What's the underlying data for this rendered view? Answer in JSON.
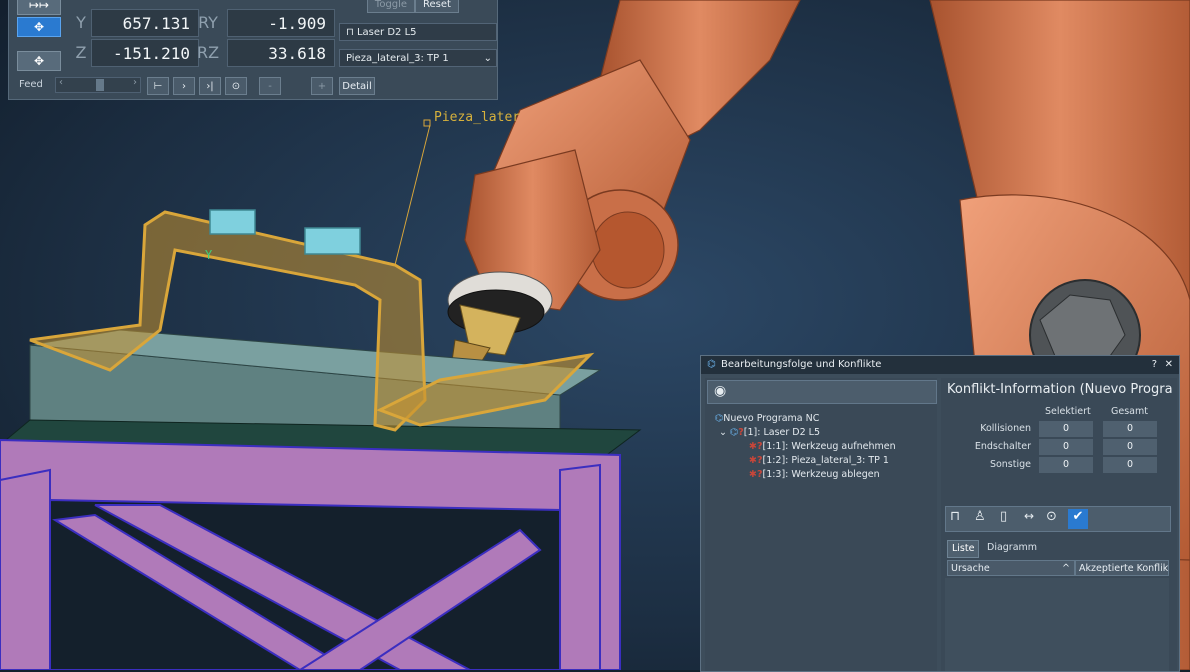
{
  "jog_panel": {
    "axes": [
      {
        "label": "Y",
        "value": "657.131",
        "rot_label": "RY",
        "rot_value": "-1.909"
      },
      {
        "label": "Z",
        "value": "-151.210",
        "rot_label": "RZ",
        "rot_value": "33.618"
      }
    ],
    "toggle_label": "Toggle",
    "reset_label": "Reset",
    "tool_field": "Laser D2 L5",
    "target_field": "Pieza_lateral_3: TP 1",
    "feed_label": "Feed",
    "minus_label": "-",
    "plus_label": "+",
    "detail_label": "Detail"
  },
  "scene": {
    "part_label": "Pieza_later",
    "axis_label": "Y"
  },
  "dialog": {
    "title": "Bearbeitungsfolge und Konflikte",
    "help_label": "?",
    "close_label": "✕",
    "tree": {
      "root": "Nuevo Programa NC",
      "child": "[1]: Laser D2 L5",
      "items": [
        "[1:1]: Werkzeug aufnehmen",
        "[1:2]: Pieza_lateral_3: TP 1",
        "[1:3]: Werkzeug ablegen"
      ]
    },
    "konflikt": {
      "title": "Konflikt-Information (Nuevo Programa NC",
      "col_selected": "Selektiert",
      "col_total": "Gesamt",
      "rows": [
        {
          "label": "Kollisionen",
          "selected": "0",
          "total": "0"
        },
        {
          "label": "Endschalter",
          "selected": "0",
          "total": "0"
        },
        {
          "label": "Sonstige",
          "selected": "0",
          "total": "0"
        }
      ],
      "tabs": [
        "Liste",
        "Diagramm"
      ],
      "col_ursache": "Ursache",
      "col_akzeptiert": "Akzeptierte Konflik"
    }
  },
  "colors": {
    "robot": "#c86a45",
    "part": "#d9a63a",
    "fixture": "#b07ab9",
    "accent": "#2a7ad0"
  }
}
